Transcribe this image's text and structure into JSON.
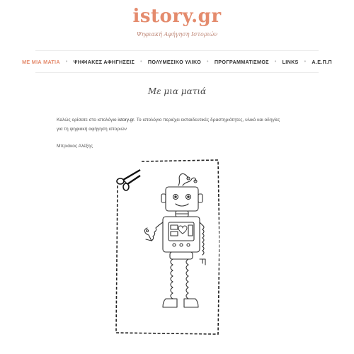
{
  "header": {
    "site_title": "istory.gr",
    "tagline": "Ψηφιακή Αφήγηση Ιστοριών"
  },
  "nav": {
    "items": [
      {
        "label": "ΜΕ ΜΙΑ ΜΑΤΙΑ",
        "active": true
      },
      {
        "label": "ΨΗΦΙΑΚΕΣ ΑΦΗΓΗΣΕΙΣ",
        "active": false
      },
      {
        "label": "ΠΟΛΥΜΕΣΙΚΟ ΥΛΙΚΟ",
        "active": false
      },
      {
        "label": "ΠΡΟΓΡΑΜΜΑΤΙΣΜΟΣ",
        "active": false
      },
      {
        "label": "LINKS",
        "active": false
      },
      {
        "label": "Α.Ε.Π.Π",
        "active": false
      }
    ],
    "separator": "•"
  },
  "main": {
    "page_title": "Με μια ματιά",
    "intro_prefix": "Καλώς ορίσατε στο ιστολόγιο ",
    "intro_site": "istory.gr",
    "intro_suffix": ". Το ιστολόγιο περιέχει εκπαιδευτικές δραστηριότητες, υλικό και οδηγίες για τη ψηφιακή αφήγηση ιστοριών",
    "author": "Μπριάκος Αλέξης"
  },
  "image": {
    "icon": "scissors-icon",
    "subject": "robot-cutout-illustration"
  },
  "colors": {
    "accent": "#e48b6d",
    "text": "#555555",
    "nav_text": "#333333"
  }
}
